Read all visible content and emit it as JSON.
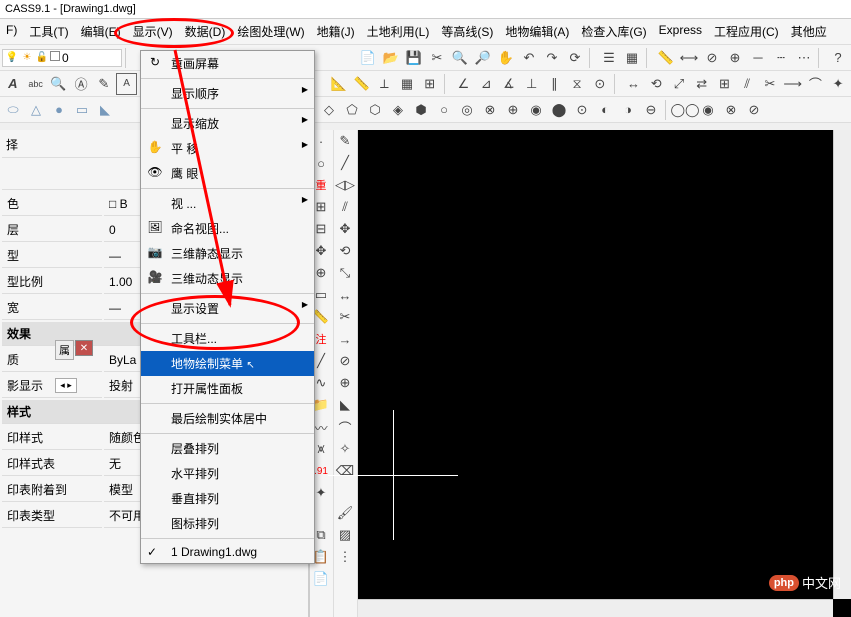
{
  "app": {
    "title": "CASS9.1 - [Drawing1.dwg]"
  },
  "menu": {
    "items": [
      {
        "label": "F)"
      },
      {
        "label": "工具(T)"
      },
      {
        "label": "编辑(E)"
      },
      {
        "label": "显示(V)"
      },
      {
        "label": "数据(D)"
      },
      {
        "label": "绘图处理(W)"
      },
      {
        "label": "地籍(J)"
      },
      {
        "label": "土地利用(L)"
      },
      {
        "label": "等高线(S)"
      },
      {
        "label": "地物编辑(A)"
      },
      {
        "label": "检查入库(G)"
      },
      {
        "label": "Express"
      },
      {
        "label": "工程应用(C)"
      },
      {
        "label": "其他应"
      }
    ]
  },
  "dropdown": {
    "items": [
      {
        "label": "重画屏幕",
        "icon": "↻"
      },
      {
        "label": "显示顺序",
        "sub": true
      },
      {
        "label": "显示缩放",
        "sub": true
      },
      {
        "label": "平    移",
        "sub": true,
        "icon": "✋"
      },
      {
        "label": "鹰    眼",
        "icon": "👁"
      },
      {
        "label": "视    ...",
        "sub": true
      },
      {
        "label": "命名视图...",
        "icon": "🖼"
      },
      {
        "label": "三维静态显示",
        "icon": "📷"
      },
      {
        "label": "三维动态显示",
        "icon": "🎥"
      },
      {
        "label": "显示设置",
        "sub": true
      },
      {
        "label": "工具栏..."
      },
      {
        "label": "地物绘制菜单",
        "highlighted": true
      },
      {
        "label": "打开属性面板"
      },
      {
        "label": "最后绘制实体居中"
      },
      {
        "label": "层叠排列"
      },
      {
        "label": "水平排列"
      },
      {
        "label": "垂直排列"
      },
      {
        "label": "图标排列"
      },
      {
        "label": "1 Drawing1.dwg",
        "check": true
      }
    ]
  },
  "properties": {
    "section0": "择",
    "rows": [
      {
        "label": "色",
        "value": "□ B"
      },
      {
        "label": "层",
        "value": "0"
      },
      {
        "label": "型",
        "value": "—"
      },
      {
        "label": "型比例",
        "value": "1.00"
      },
      {
        "label": "宽",
        "value": "—"
      }
    ],
    "section1": "效果",
    "rows1": [
      {
        "label": "质",
        "value": "ByLa"
      },
      {
        "label": "影显示",
        "value": "投射"
      }
    ],
    "section2": "样式",
    "rows2": [
      {
        "label": "印样式",
        "value": "随颜色"
      },
      {
        "label": "印样式表",
        "value": "无"
      },
      {
        "label": "印表附着到",
        "value": "模型"
      },
      {
        "label": "印表类型",
        "value": "不可用"
      }
    ]
  },
  "layer": {
    "current": "0"
  },
  "side_labels": {
    "zhong": "重",
    "zhu": "注",
    "point91": ".91"
  },
  "watermark": {
    "php": "php",
    "text": "中文网"
  },
  "floating": {
    "label": "属"
  }
}
